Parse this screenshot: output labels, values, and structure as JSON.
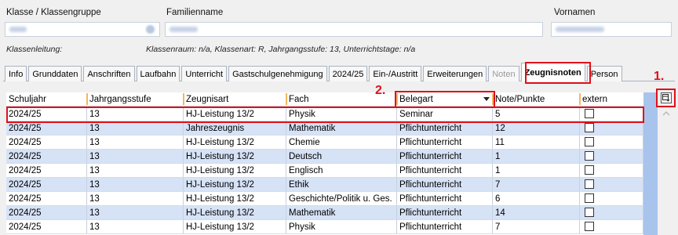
{
  "header": {
    "klasse_label": "Klasse / Klassengruppe",
    "familienname_label": "Familienname",
    "vornamen_label": "Vornamen",
    "klassenleitung_label": "Klassenleitung:",
    "class_info": "Klassenraum: n/a, Klassenart: R, Jahrgangsstufe: 13, Unterrichtstage: n/a"
  },
  "tabs": [
    {
      "label": "Info",
      "name": "tab-info"
    },
    {
      "label": "Grunddaten",
      "name": "tab-grunddaten"
    },
    {
      "label": "Anschriften",
      "name": "tab-anschriften"
    },
    {
      "label": "Laufbahn",
      "name": "tab-laufbahn"
    },
    {
      "label": "Unterricht",
      "name": "tab-unterricht"
    },
    {
      "label": "Gastschulgenehmigung",
      "name": "tab-gastschulgenehmigung"
    },
    {
      "label": "2024/25",
      "name": "tab-2024-25"
    },
    {
      "label": "Ein-/Austritt",
      "name": "tab-ein-austritt"
    },
    {
      "label": "Erweiterungen",
      "name": "tab-erweiterungen"
    },
    {
      "label": "Noten",
      "name": "tab-noten",
      "disabled": true
    },
    {
      "label": "Zeugnisnoten",
      "name": "tab-zeugnisnoten",
      "active": true
    },
    {
      "label": "Person",
      "name": "tab-person"
    }
  ],
  "grid": {
    "columns": [
      "Schuljahr",
      "Jahrgangsstufe",
      "Zeugnisart",
      "Fach",
      "Belegart",
      "Note/Punkte",
      "extern"
    ],
    "rows": [
      [
        "2024/25",
        "13",
        "HJ-Leistung 13/2",
        "Physik",
        "Seminar",
        "5"
      ],
      [
        "2024/25",
        "13",
        "Jahreszeugnis",
        "Mathematik",
        "Pflichtunterricht",
        "12"
      ],
      [
        "2024/25",
        "13",
        "HJ-Leistung 13/2",
        "Chemie",
        "Pflichtunterricht",
        "11"
      ],
      [
        "2024/25",
        "13",
        "HJ-Leistung 13/2",
        "Deutsch",
        "Pflichtunterricht",
        "1"
      ],
      [
        "2024/25",
        "13",
        "HJ-Leistung 13/2",
        "Englisch",
        "Pflichtunterricht",
        "1"
      ],
      [
        "2024/25",
        "13",
        "HJ-Leistung 13/2",
        "Ethik",
        "Pflichtunterricht",
        "7"
      ],
      [
        "2024/25",
        "13",
        "HJ-Leistung 13/2",
        "Geschichte/Politik u. Ges.",
        "Pflichtunterricht",
        "6"
      ],
      [
        "2024/25",
        "13",
        "HJ-Leistung 13/2",
        "Mathematik",
        "Pflichtunterricht",
        "14"
      ],
      [
        "2024/25",
        "13",
        "HJ-Leistung 13/2",
        "Physik",
        "Pflichtunterricht",
        "7"
      ]
    ]
  },
  "annotations": {
    "one": "1.",
    "two": "2."
  },
  "colors": {
    "accent_red": "#e0101a",
    "row_alt": "#d6e2f6",
    "header_sep": "#f0b860"
  }
}
